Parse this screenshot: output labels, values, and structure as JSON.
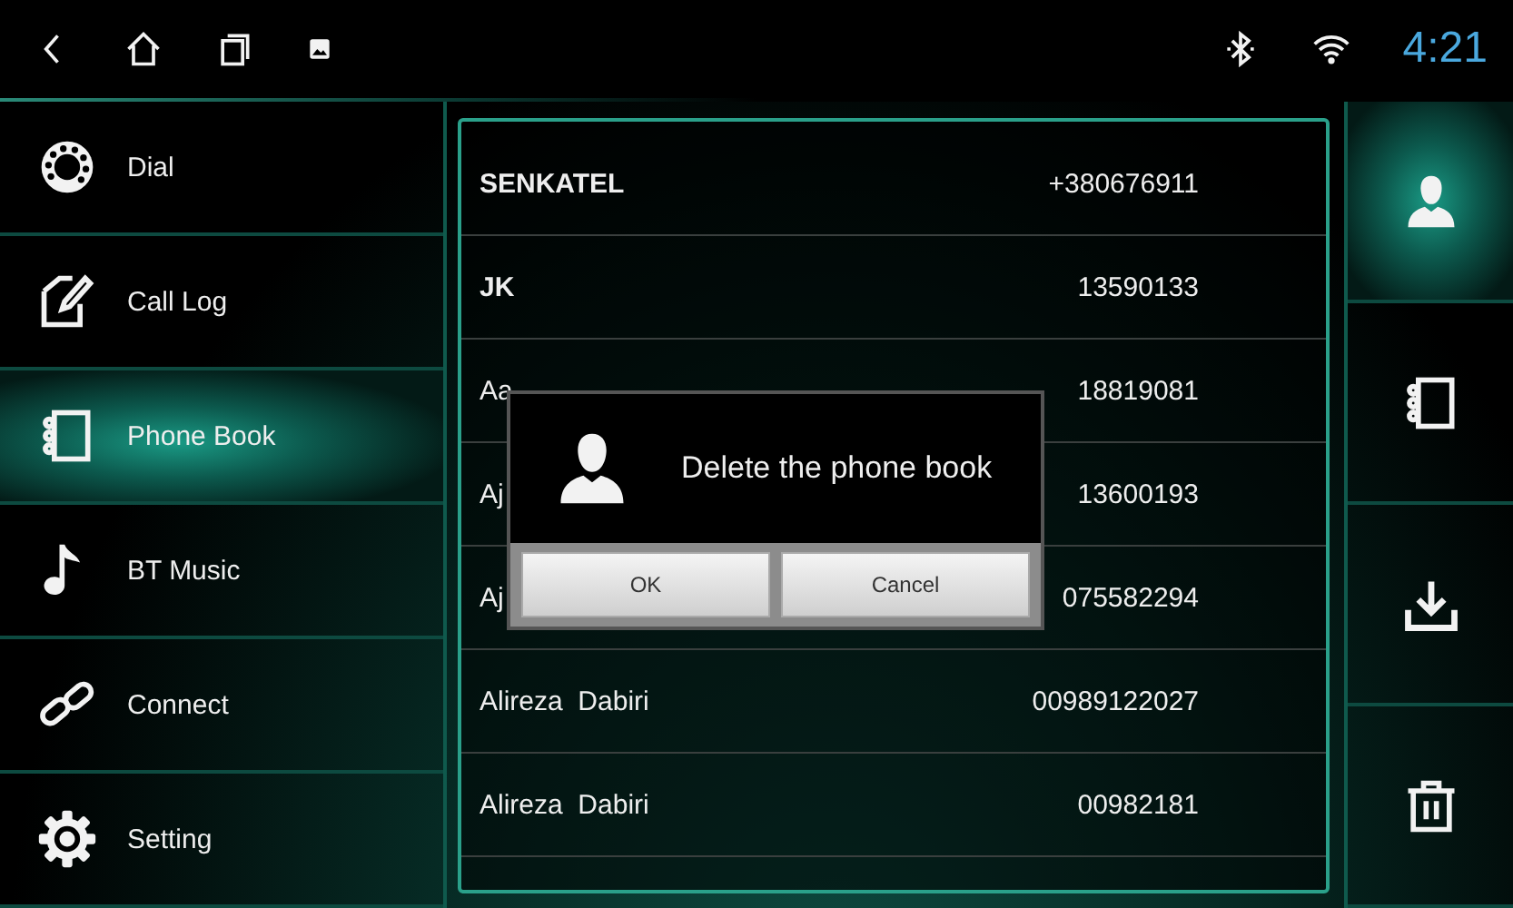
{
  "status_bar": {
    "time": "4:21"
  },
  "sidebar": {
    "items": [
      {
        "label": "Dial",
        "kind": "dial",
        "selected": false
      },
      {
        "label": "Call Log",
        "kind": "calllog",
        "selected": false
      },
      {
        "label": "Phone Book",
        "kind": "phonebook",
        "selected": true
      },
      {
        "label": "BT Music",
        "kind": "music",
        "selected": false
      },
      {
        "label": "Connect",
        "kind": "connect",
        "selected": false
      },
      {
        "label": "Setting",
        "kind": "setting",
        "selected": false
      }
    ]
  },
  "contacts": [
    {
      "name": "SENKATEL",
      "number": "+380676911"
    },
    {
      "name": "JK",
      "number": "13590133"
    },
    {
      "name": "Aa",
      "number": "18819081"
    },
    {
      "name": "Aj",
      "number": "13600193"
    },
    {
      "name": "Aj",
      "number": "075582294"
    },
    {
      "name": "Alireza  Dabiri",
      "number": "00989122027"
    },
    {
      "name": "Alireza  Dabiri",
      "number": "00982181"
    }
  ],
  "dialog": {
    "message": "Delete the phone book",
    "buttons": [
      "OK",
      "Cancel"
    ]
  },
  "actions": [
    {
      "kind": "contacts",
      "selected": true
    },
    {
      "kind": "phonebook",
      "selected": false
    },
    {
      "kind": "download",
      "selected": false
    },
    {
      "kind": "delete",
      "selected": false
    }
  ]
}
